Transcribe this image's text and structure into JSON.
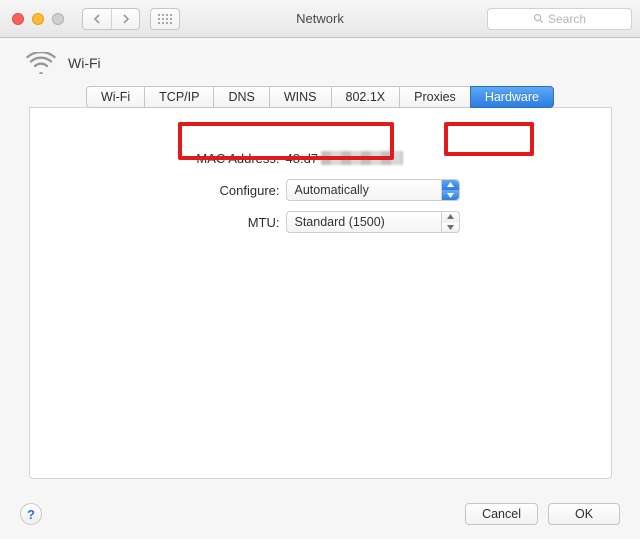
{
  "window": {
    "title": "Network",
    "search_placeholder": "Search"
  },
  "connection": {
    "name": "Wi-Fi",
    "icon": "wifi-icon"
  },
  "tabs": [
    {
      "id": "wifi",
      "label": "Wi-Fi",
      "active": false
    },
    {
      "id": "tcpip",
      "label": "TCP/IP",
      "active": false
    },
    {
      "id": "dns",
      "label": "DNS",
      "active": false
    },
    {
      "id": "wins",
      "label": "WINS",
      "active": false
    },
    {
      "id": "8021x",
      "label": "802.1X",
      "active": false
    },
    {
      "id": "proxies",
      "label": "Proxies",
      "active": false
    },
    {
      "id": "hardware",
      "label": "Hardware",
      "active": true
    }
  ],
  "hardware": {
    "mac_label": "MAC Address:",
    "mac_visible_prefix": "48:d7",
    "mac_remainder_redacted": true,
    "configure_label": "Configure:",
    "configure_value": "Automatically",
    "mtu_label": "MTU:",
    "mtu_value": "Standard  (1500)"
  },
  "footer": {
    "help": "?",
    "cancel": "Cancel",
    "ok": "OK"
  },
  "highlights": [
    {
      "target": "tab-hardware"
    },
    {
      "target": "mac-address-row"
    }
  ]
}
